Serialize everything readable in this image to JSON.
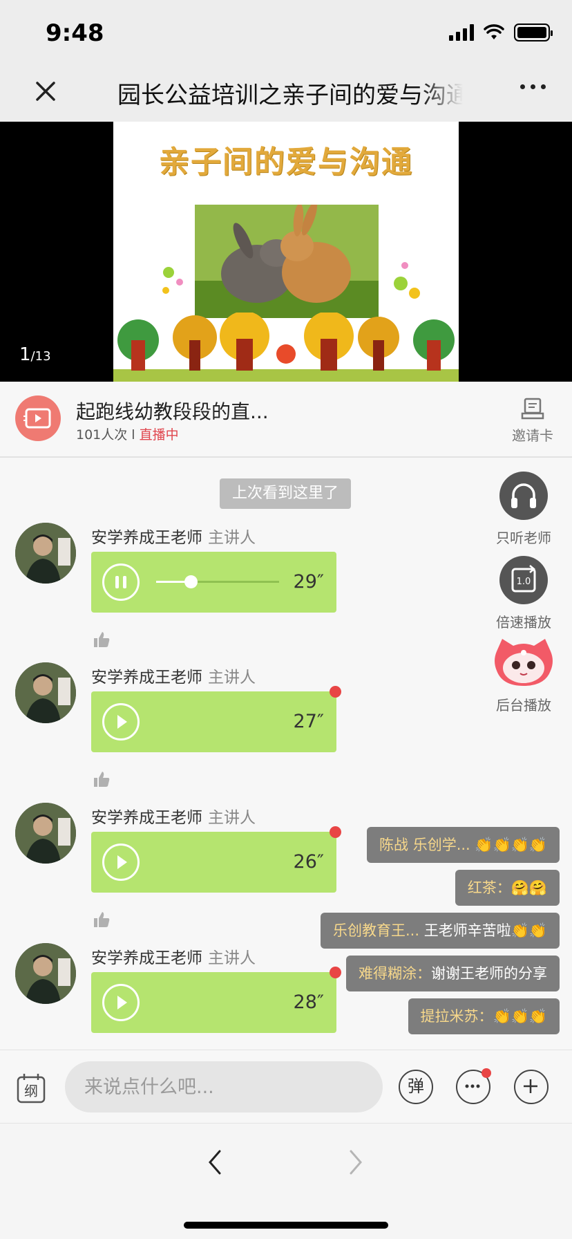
{
  "status_bar": {
    "time": "9:48"
  },
  "nav": {
    "title": "园长公益培训之亲子间的爱与沟通"
  },
  "video": {
    "slide_title": "亲子间的爱与沟通",
    "page_current": "1",
    "page_total": "/13"
  },
  "live": {
    "channel_name": "起跑线幼教段段的直...",
    "views": "101人次 l ",
    "status": "直播中",
    "invite_label": "邀请卡"
  },
  "chat": {
    "last_seen_label": "上次看到这里了",
    "messages": [
      {
        "sender": "安学养成王老师",
        "role": "主讲人",
        "duration": "29″",
        "state": "playing",
        "progress": 0.28,
        "unread": false
      },
      {
        "sender": "安学养成王老师",
        "role": "主讲人",
        "duration": "27″",
        "state": "paused",
        "unread": true
      },
      {
        "sender": "安学养成王老师",
        "role": "主讲人",
        "duration": "26″",
        "state": "paused",
        "unread": true
      },
      {
        "sender": "安学养成王老师",
        "role": "主讲人",
        "duration": "28″",
        "state": "paused",
        "unread": true
      }
    ]
  },
  "side_actions": {
    "listen_teacher": "只听老师",
    "speed_play": "倍速播放",
    "speed_value": "1.0",
    "background_play": "后台播放"
  },
  "danmaku": [
    {
      "name": "陈战 乐创学...",
      "text": " 👏👏👏👏"
    },
    {
      "name": "红茶：",
      "text": "🤗🤗"
    },
    {
      "name": "乐创教育王...",
      "text": " 王老师辛苦啦👏👏"
    },
    {
      "name": "难得糊涂：",
      "text": "谢谢王老师的分享"
    },
    {
      "name": "提拉米苏：",
      "text": "👏👏👏"
    }
  ],
  "input_bar": {
    "outline_label": "纲",
    "placeholder": "来说点什么吧...",
    "danmaku_btn": "弹"
  },
  "colors": {
    "voice_bubble": "#b5e46f",
    "live_status": "#e0454d",
    "unread_dot": "#e84545"
  }
}
